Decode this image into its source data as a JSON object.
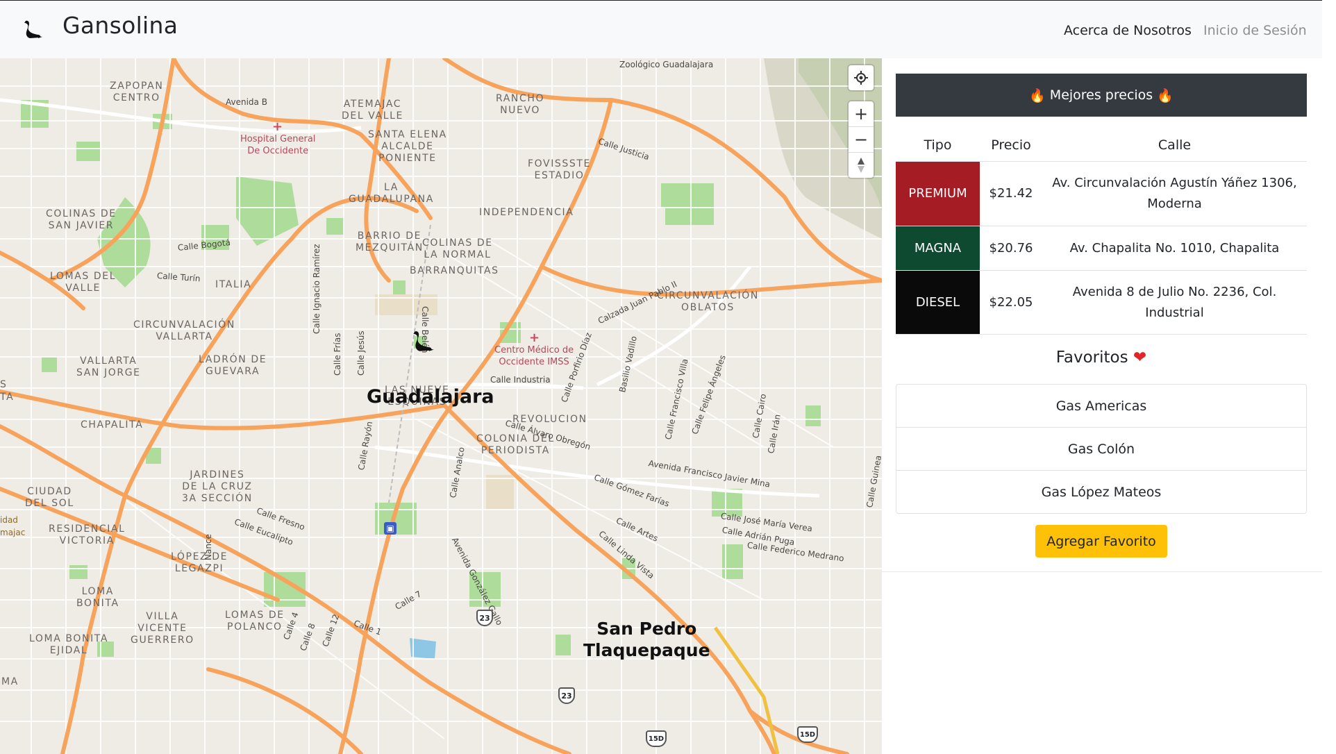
{
  "app": {
    "title": "Gansolina",
    "nav": {
      "about": "Acerca de Nosotros",
      "login": "Inicio de Sesión"
    }
  },
  "map": {
    "districts": [
      "ZAPOPAN\nCENTRO",
      "ATEMAJAC\nDEL VALLE",
      "RANCHO\nNUEVO",
      "SANTA ELENA\nALCALDE\nPONIENTE",
      "FOVISSSTE\nESTADIO",
      "LA\nGUADALUPANA",
      "COLINAS DE\nSAN JAVIER",
      "INDEPENDENCIA",
      "BARRIO DE\nMEZQUITÁN",
      "COLINAS DE\nLA NORMAL",
      "BARRANQUITAS",
      "LOMAS DEL\nVALLE",
      "ITALIA",
      "CIRCUNVALACIÓN\nOBLATOS",
      "CIRCUNVALACIÓN\nVALLARTA",
      "VALLARTA\nSAN JORGE",
      "LADRÓN DE\nGUEVARA",
      "LAS NUEVE\nESQUINAS",
      "REVOLUCION",
      "COLONIA DEL\nPERIODISTA",
      "CHAPALITA",
      "CIUDAD\nDEL SOL",
      "JARDINES\nDE LA CRUZ\n3A SECCIÓN",
      "RESIDENCIAL\nVICTORIA",
      "LÓPEZ DE\nLEGAZPI",
      "LOMA\nBONITA",
      "VILLA\nVICENTE\nGUERRERO",
      "LOMAS DE\nPOLANCO",
      "LOMA BONITA\nEJIDAL"
    ],
    "streets": [
      "Avenida B",
      "Calle Bogotá",
      "Calle Turín",
      "Calle Justicia",
      "Zoológico Guadalajara",
      "Calle Ignacio Ramírez",
      "Calle Frías",
      "Calle Jesús",
      "Calle Belén",
      "Calle Industria",
      "Calle Porfirio Díaz",
      "Basilio Vadillo",
      "Calle Francisco Villa",
      "Calle Felipe Ángeles",
      "Calle Cairo",
      "Calle Irán",
      "Calzada Juan Pablo II",
      "Calle Álvaro Obregón",
      "Avenida Francisco Javier Mina",
      "Calle Gómez Farías",
      "Calle Rayón",
      "Calle Analco",
      "Calle Artes",
      "Calle Linda Vista",
      "Calle José María Verea",
      "Calle Adrián Puga",
      "Calle Federico Medrano",
      "Calle Fresno",
      "Calle Eucalipto",
      "Nance",
      "Calle 7",
      "Calle 4",
      "Calle 8",
      "Calle 12",
      "Calle 1",
      "Avenida González Gallo",
      "Calle Guinea"
    ],
    "pois": [
      "Hospital General\nDe Occidente",
      "Centro Médico de\nOccidente IMSS"
    ],
    "cities": {
      "main": "Guadalajara",
      "secondary": "San Pedro\nTlaquepaque"
    },
    "shields": [
      "23",
      "23",
      "23",
      "15D",
      "15D"
    ],
    "edge_fragments": [
      "idad",
      "majac",
      "MA",
      "TA",
      "S"
    ]
  },
  "best_prices": {
    "title": "Mejores precios",
    "columns": [
      "Tipo",
      "Precio",
      "Calle"
    ],
    "rows": [
      {
        "tipo": "PREMIUM",
        "precio": "$21.42",
        "calle": "Av. Circunvalación Agustín Yáñez 1306, Moderna",
        "color": "#a51c24"
      },
      {
        "tipo": "MAGNA",
        "precio": "$20.76",
        "calle": "Av. Chapalita No. 1010, Chapalita",
        "color": "#0d4a30"
      },
      {
        "tipo": "DIESEL",
        "precio": "$22.05",
        "calle": "Avenida 8 de Julio No. 2236, Col. Industrial",
        "color": "#0a0a0a"
      }
    ]
  },
  "favorites": {
    "title": "Favoritos",
    "items": [
      "Gas Americas",
      "Gas Colón",
      "Gas López Mateos"
    ],
    "add_label": "Agregar Favorito"
  }
}
